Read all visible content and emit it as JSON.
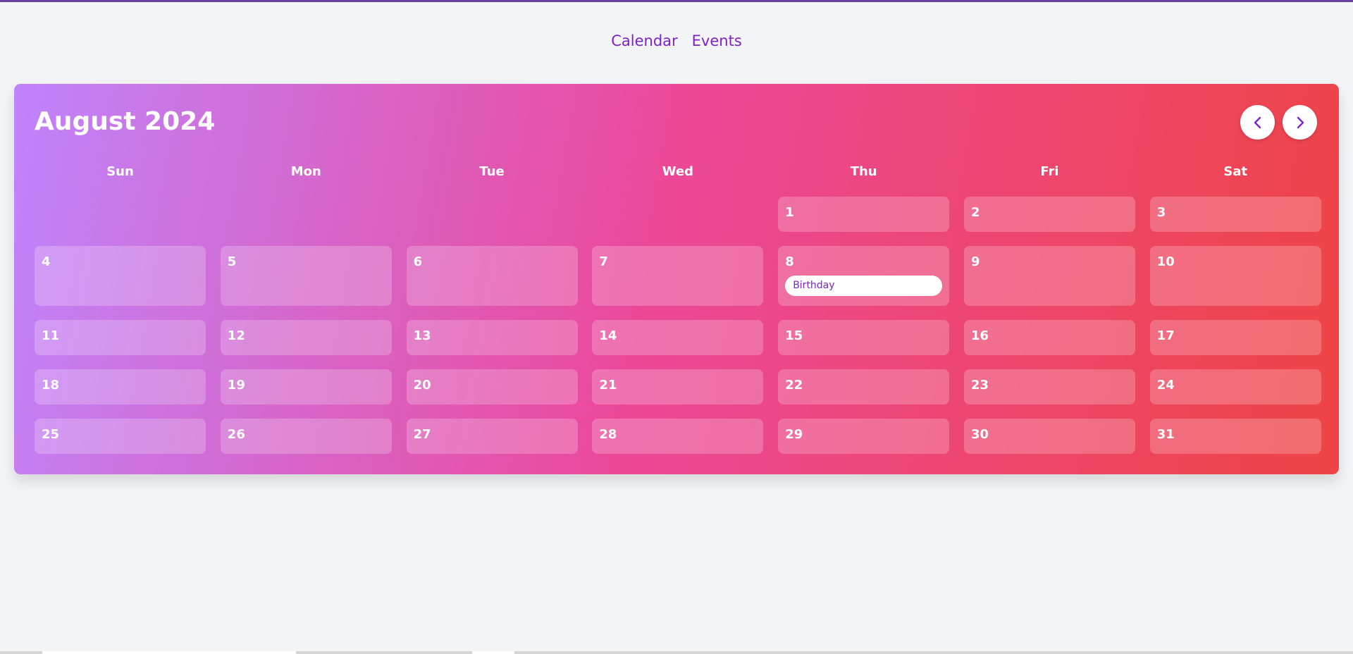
{
  "nav": {
    "links": [
      {
        "label": "Calendar"
      },
      {
        "label": "Events"
      }
    ]
  },
  "calendar": {
    "month_title": "August 2024",
    "prev_icon": "chevron-left-icon",
    "next_icon": "chevron-right-icon",
    "weekdays": [
      "Sun",
      "Mon",
      "Tue",
      "Wed",
      "Thu",
      "Fri",
      "Sat"
    ],
    "leading_empty_days": 4,
    "days": [
      {
        "number": "1"
      },
      {
        "number": "2"
      },
      {
        "number": "3"
      },
      {
        "number": "4"
      },
      {
        "number": "5"
      },
      {
        "number": "6"
      },
      {
        "number": "7"
      },
      {
        "number": "8",
        "events": [
          "Birthday"
        ]
      },
      {
        "number": "9"
      },
      {
        "number": "10"
      },
      {
        "number": "11"
      },
      {
        "number": "12"
      },
      {
        "number": "13"
      },
      {
        "number": "14"
      },
      {
        "number": "15"
      },
      {
        "number": "16"
      },
      {
        "number": "17"
      },
      {
        "number": "18"
      },
      {
        "number": "19"
      },
      {
        "number": "20"
      },
      {
        "number": "21"
      },
      {
        "number": "22"
      },
      {
        "number": "23"
      },
      {
        "number": "24"
      },
      {
        "number": "25"
      },
      {
        "number": "26"
      },
      {
        "number": "27"
      },
      {
        "number": "28"
      },
      {
        "number": "29"
      },
      {
        "number": "30"
      },
      {
        "number": "31"
      }
    ]
  },
  "colors": {
    "accent": "#7e22ce",
    "gradient_start": "#c084fc",
    "gradient_mid": "#ec4899",
    "gradient_end": "#ef4444"
  }
}
